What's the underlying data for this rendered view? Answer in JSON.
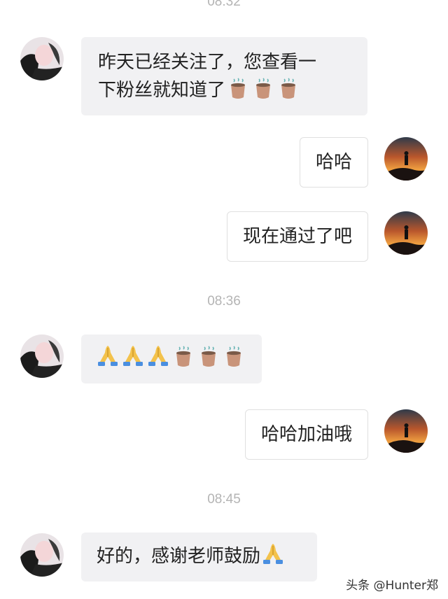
{
  "timestamps": [
    "08:32",
    "08:36",
    "08:45"
  ],
  "messages": [
    {
      "side": "in",
      "line1": "昨天已经关注了，您查看一",
      "line2": "下粉丝就知道了",
      "emojis": [
        "tea-icon",
        "tea-icon",
        "tea-icon"
      ]
    },
    {
      "side": "out",
      "text": "哈哈"
    },
    {
      "side": "out",
      "text": "现在通过了吧"
    },
    {
      "side": "in",
      "text": "",
      "emojis": [
        "pray-icon",
        "pray-icon",
        "pray-icon",
        "tea-icon",
        "tea-icon",
        "tea-icon"
      ]
    },
    {
      "side": "out",
      "text": "哈哈加油哦"
    },
    {
      "side": "in",
      "text": "好的，感谢老师鼓励",
      "emojis": [
        "pray-icon"
      ]
    }
  ],
  "watermark": "头条 @Hunter郑",
  "colors": {
    "incoming_bubble": "#f1f1f3",
    "outgoing_bubble": "#ffffff",
    "timestamp": "#b4b4b4"
  }
}
